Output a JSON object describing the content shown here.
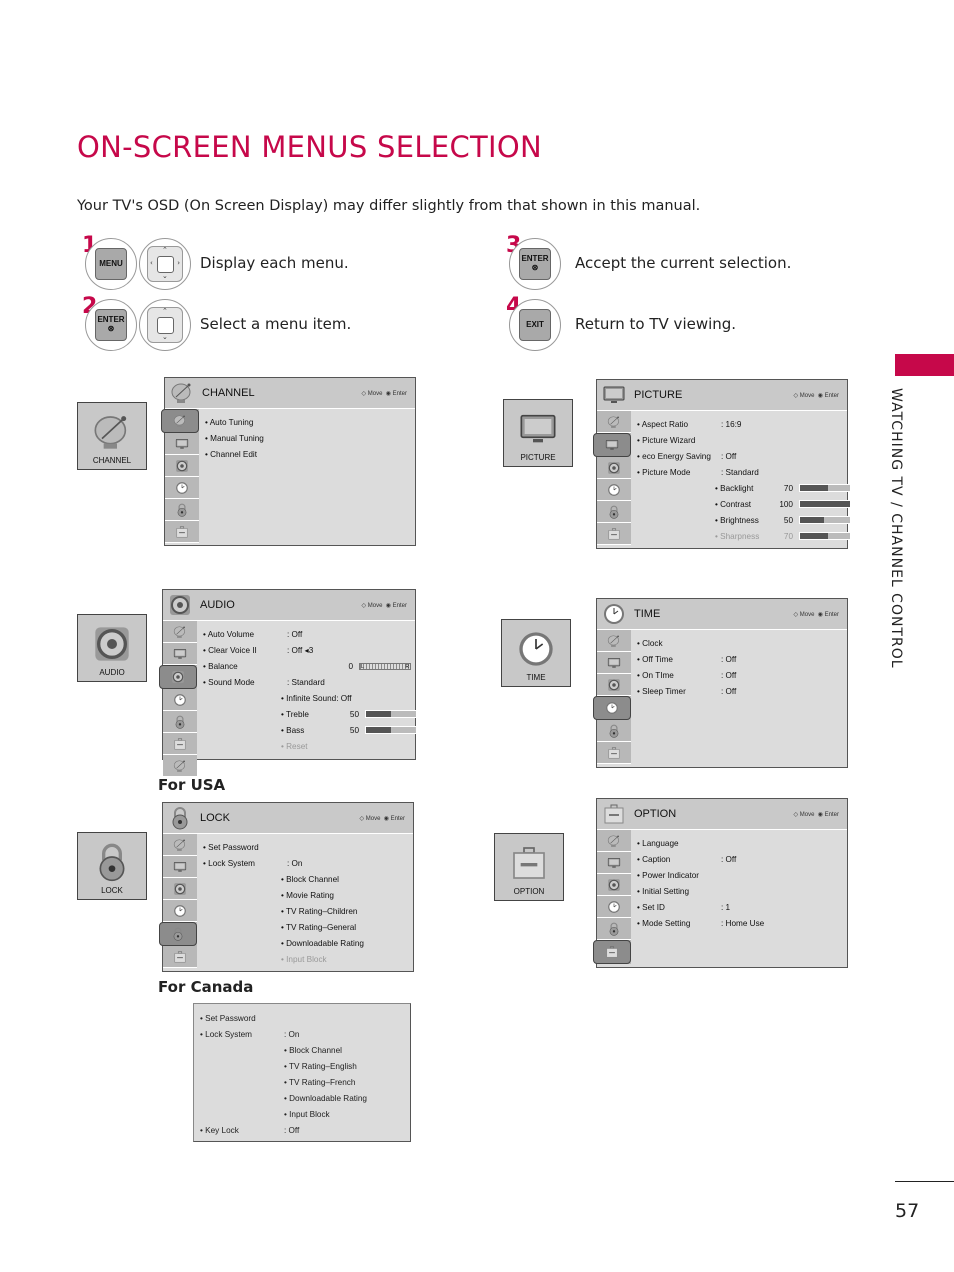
{
  "page": {
    "title": "ON-SCREEN MENUS SELECTION",
    "intro": "Your TV's OSD (On Screen Display) may differ slightly from that shown in this manual.",
    "side_tab": "WATCHING TV / CHANNEL CONTROL",
    "page_number": "57",
    "accent_color": "#c6084a"
  },
  "steps": [
    {
      "number": "1",
      "keys": [
        "MENU",
        "dpad-4way"
      ],
      "text": "Display each menu."
    },
    {
      "number": "2",
      "keys": [
        "ENTER",
        "dpad-updown"
      ],
      "text": "Select a menu item."
    },
    {
      "number": "3",
      "keys": [
        "ENTER"
      ],
      "text": "Accept the current selection."
    },
    {
      "number": "4",
      "keys": [
        "EXIT"
      ],
      "text": "Return to TV viewing."
    }
  ],
  "key_labels": {
    "menu": "MENU",
    "enter": "ENTER",
    "enter_symbol": "⊛",
    "exit": "EXIT"
  },
  "hints": {
    "move": "Move",
    "enter": "Enter"
  },
  "menus": {
    "channel": {
      "thumb_label": "CHANNEL",
      "title": "CHANNEL",
      "selected_index": 0,
      "items": [
        {
          "label": "• Auto Tuning"
        },
        {
          "label": "• Manual Tuning"
        },
        {
          "label": "• Channel Edit"
        }
      ]
    },
    "picture": {
      "thumb_label": "PICTURE",
      "title": "PICTURE",
      "selected_index": 1,
      "items": [
        {
          "label": "• Aspect Ratio",
          "value": ": 16:9"
        },
        {
          "label": "• Picture Wizard",
          "value": ""
        },
        {
          "label": "• eco Energy Saving",
          "value": ": Off"
        },
        {
          "label": "• Picture Mode",
          "value": ": Standard"
        }
      ],
      "sliders": [
        {
          "label": "• Backlight",
          "value": "70",
          "level": 0.55
        },
        {
          "label": "• Contrast",
          "value": "100",
          "level": 1.0
        },
        {
          "label": "• Brightness",
          "value": "50",
          "level": 0.48
        },
        {
          "label": "• Sharpness",
          "value": "70",
          "level": 0.55,
          "faded": true
        }
      ]
    },
    "audio": {
      "thumb_label": "AUDIO",
      "title": "AUDIO",
      "selected_index": 2,
      "items": [
        {
          "label": "• Auto Volume",
          "value": ": Off"
        },
        {
          "label": "• Clear Voice II",
          "value": ": Off ◂3"
        },
        {
          "label": "• Balance",
          "value": "0",
          "balance_left": "L",
          "balance_right": "R"
        },
        {
          "label": "• Sound Mode",
          "value": ": Standard"
        }
      ],
      "sub_items": [
        {
          "label": "• Infinite Sound",
          "value": ": Off"
        },
        {
          "label": "• Treble",
          "value": "50",
          "level": 0.5
        },
        {
          "label": "• Bass",
          "value": "50",
          "level": 0.5
        },
        {
          "label": "• Reset",
          "faded": true
        }
      ]
    },
    "time": {
      "thumb_label": "TIME",
      "title": "TIME",
      "selected_index": 3,
      "items": [
        {
          "label": "• Clock",
          "value": ""
        },
        {
          "label": "• Off Time",
          "value": ": Off"
        },
        {
          "label": "• On TIme",
          "value": ": Off"
        },
        {
          "label": "• Sleep Timer",
          "value": ": Off"
        }
      ]
    },
    "lock_usa": {
      "section_label": "For USA",
      "thumb_label": "LOCK",
      "title": "LOCK",
      "selected_index": 4,
      "items": [
        {
          "label": "• Set Password",
          "value": ""
        },
        {
          "label": "• Lock System",
          "value": ": On"
        }
      ],
      "sub_items": [
        {
          "label": "• Block Channel"
        },
        {
          "label": "• Movie Rating"
        },
        {
          "label": "• TV Rating–Children"
        },
        {
          "label": "• TV Rating–General"
        },
        {
          "label": "• Downloadable Rating"
        },
        {
          "label": "• Input Block",
          "faded": true
        }
      ]
    },
    "lock_canada": {
      "section_label": "For Canada",
      "items": [
        {
          "label": "• Set Password",
          "value": ""
        },
        {
          "label": "• Lock System",
          "value": ": On"
        }
      ],
      "sub_items": [
        {
          "label": "• Block Channel"
        },
        {
          "label": "• TV Rating–English"
        },
        {
          "label": "• TV Rating–French"
        },
        {
          "label": "• Downloadable Rating"
        },
        {
          "label": "• Input Block"
        }
      ],
      "tail_items": [
        {
          "label": "• Key Lock",
          "value": ": Off"
        }
      ]
    },
    "option": {
      "thumb_label": "OPTION",
      "title": "OPTION",
      "selected_index": 5,
      "items": [
        {
          "label": "• Language",
          "value": ""
        },
        {
          "label": "• Caption",
          "value": ": Off"
        },
        {
          "label": "• Power Indicator",
          "value": ""
        },
        {
          "label": "• Initial Setting",
          "value": ""
        },
        {
          "label": "• Set ID",
          "value": ": 1"
        },
        {
          "label": "• Mode Setting",
          "value": ": Home Use"
        }
      ]
    }
  }
}
